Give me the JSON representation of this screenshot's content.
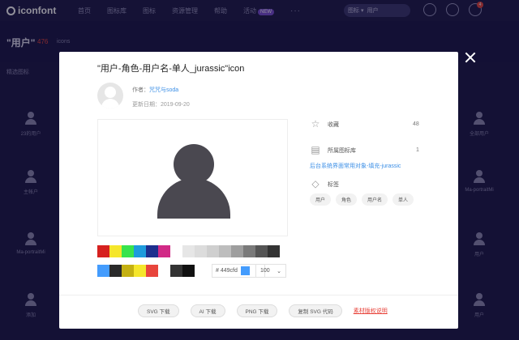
{
  "nav": {
    "logo": "iconfont",
    "items": [
      {
        "label": "首页"
      },
      {
        "label": "图标库"
      },
      {
        "label": "图标"
      },
      {
        "label": "资源管理"
      },
      {
        "label": "帮助"
      },
      {
        "label": "活动",
        "badge": "NEW"
      }
    ],
    "more": "···",
    "search_scope": "图标 ▾",
    "search_text": "用户"
  },
  "subheader": {
    "title": "\"用户\"",
    "count": "476",
    "unit": "icons"
  },
  "bg": {
    "section": "精选图标",
    "icons": [
      {
        "label": "23的用户"
      },
      {
        "label": "主帐户"
      },
      {
        "label": "Ma-portraitMi"
      },
      {
        "label": "添加"
      },
      {
        "label": "全部用户"
      },
      {
        "label": "Ma-portraitMi"
      },
      {
        "label": "用户"
      },
      {
        "label": "用户"
      }
    ]
  },
  "modal": {
    "title": "\"用户-角色-用户名-单人_jurassic\"icon",
    "author_label": "作者：",
    "author_name": "咒咒与soda",
    "date": "更新日期：2019-09-20",
    "colors_row1": [
      "#d6211f",
      "#f5e62b",
      "#38e34d",
      "#1e9bdc",
      "#1e2f8e",
      "#d12a86",
      "#ffffff",
      "#e6e6e6",
      "#dcdcdc",
      "#cfcfcf",
      "#bdbdbd",
      "#9e9e9e",
      "#7a7a7a",
      "#555555",
      "#333333"
    ],
    "colors_row2": [
      "#449cfd",
      "#2a2a2a",
      "#c4b012",
      "#f5e62b",
      "#e8453c",
      "#ffffff",
      "#333333",
      "#111111"
    ],
    "hex_value": "# 449cfd",
    "size_value": "100",
    "size_arrow": "⌄",
    "favorites_label": "收藏",
    "favorites_count": "48",
    "library_label": "所属图标库",
    "library_count": "1",
    "library_name": "后台系统界面常用对象-填充-jurassic",
    "tags_label": "标签",
    "tags": [
      {
        "label": "用户"
      },
      {
        "label": "角色"
      },
      {
        "label": "用户名"
      },
      {
        "label": "单人"
      }
    ],
    "buttons": {
      "svg": "SVG 下载",
      "ai": "AI 下载",
      "png": "PNG 下载",
      "copy_svg": "复制 SVG 代码",
      "license": "素材版权说明"
    }
  }
}
